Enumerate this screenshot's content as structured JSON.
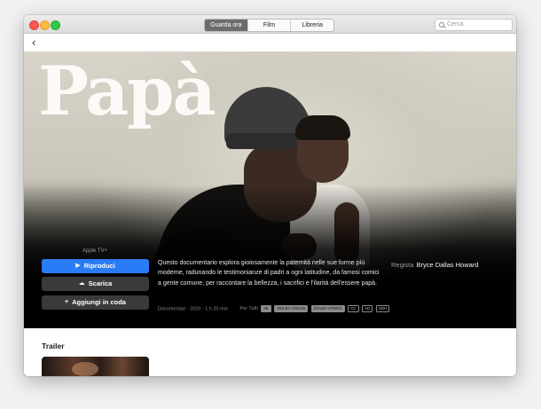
{
  "toolbar": {
    "tabs": [
      {
        "label": "Guarda ora",
        "active": true
      },
      {
        "label": "Film",
        "active": false
      },
      {
        "label": "Libreria",
        "active": false
      }
    ],
    "search_placeholder": "Cerca"
  },
  "nav": {
    "back_icon": "chevron-left-icon",
    "back_glyph": "‹"
  },
  "movie": {
    "title": "Papà",
    "provider": "Apple TV+",
    "description": "Questo documentario esplora gioiosamente la paternità nelle sue forme più moderne, radunando le testimonianze di padri a ogni latitudine, da famosi comici a gente comune, per raccontare la bellezza, i sacrifici e l'ilarità dell'essere papà.",
    "meta": "Documentari · 2020 · 1 h 20 min",
    "rating_label": "Per Tutti",
    "badges": [
      "4K",
      "DOLBY VISION",
      "DOLBY ATMOS",
      "CC",
      "AD",
      "SDH"
    ],
    "director_label": "Regista",
    "director_name": "Bryce Dallas Howard"
  },
  "actions": {
    "play_label": "Riproduci",
    "download_label": "Scarica",
    "queue_label": "Aggiungi in coda"
  },
  "sections": {
    "trailer_title": "Trailer"
  },
  "colors": {
    "accent": "#2a7cf6",
    "button_dark": "#3a3a3a",
    "hero_bg": "#000000"
  }
}
